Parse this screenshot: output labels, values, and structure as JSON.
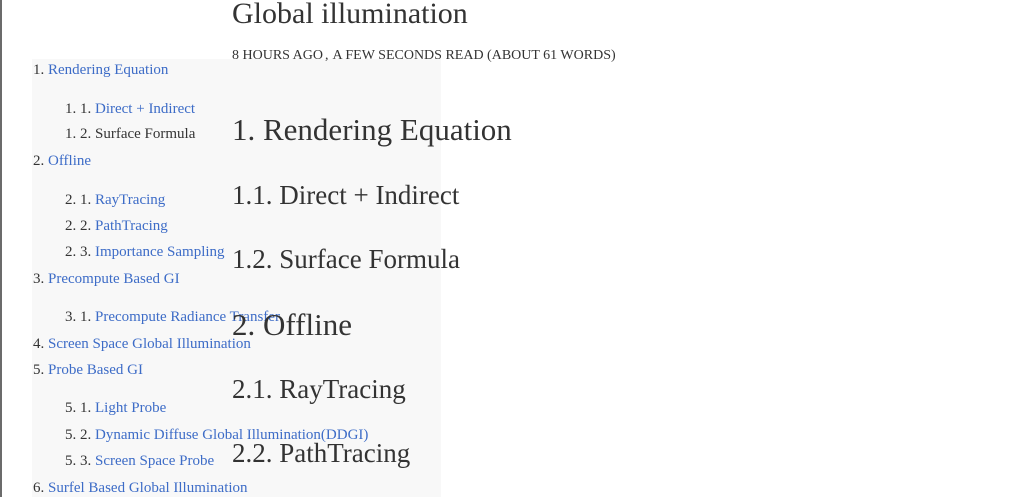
{
  "post": {
    "title": "Global illumination",
    "meta": {
      "time": "8 HOURS AGO",
      "read": "A FEW SECONDS READ (ABOUT 61 WORDS)"
    }
  },
  "toc": {
    "items": [
      {
        "num": "1.",
        "label": "Rendering Equation",
        "link": true
      },
      {
        "num": "1. 1.",
        "label": "Direct + Indirect",
        "link": true
      },
      {
        "num": "1. 2.",
        "label": "Surface Formula",
        "link": false
      },
      {
        "num": "2.",
        "label": "Offline",
        "link": true
      },
      {
        "num": "2. 1.",
        "label": "RayTracing",
        "link": true
      },
      {
        "num": "2. 2.",
        "label": "PathTracing",
        "link": true
      },
      {
        "num": "2. 3.",
        "label": "Importance Sampling",
        "link": true
      },
      {
        "num": "3.",
        "label": "Precompute Based GI",
        "link": true
      },
      {
        "num": "3. 1.",
        "label": "Precompute Radiance Transfer",
        "link": true
      },
      {
        "num": "4.",
        "label": "Screen Space Global Illumination",
        "link": true
      },
      {
        "num": "5.",
        "label": "Probe Based GI",
        "link": true
      },
      {
        "num": "5. 1.",
        "label": "Light Probe",
        "link": true
      },
      {
        "num": "5. 2.",
        "label": "Dynamic Diffuse Global Illumination(DDGI)",
        "link": true
      },
      {
        "num": "5. 3.",
        "label": "Screen Space Probe",
        "link": true
      },
      {
        "num": "6.",
        "label": "Surfel Based Global Illumination",
        "link": true
      }
    ]
  },
  "content": {
    "headings": [
      {
        "text": "1. Rendering Equation"
      },
      {
        "text": "1.1. Direct + Indirect"
      },
      {
        "text": "1.2. Surface Formula"
      },
      {
        "text": "2. Offline"
      },
      {
        "text": "2.1. RayTracing"
      },
      {
        "text": "2.2. PathTracing"
      }
    ]
  }
}
